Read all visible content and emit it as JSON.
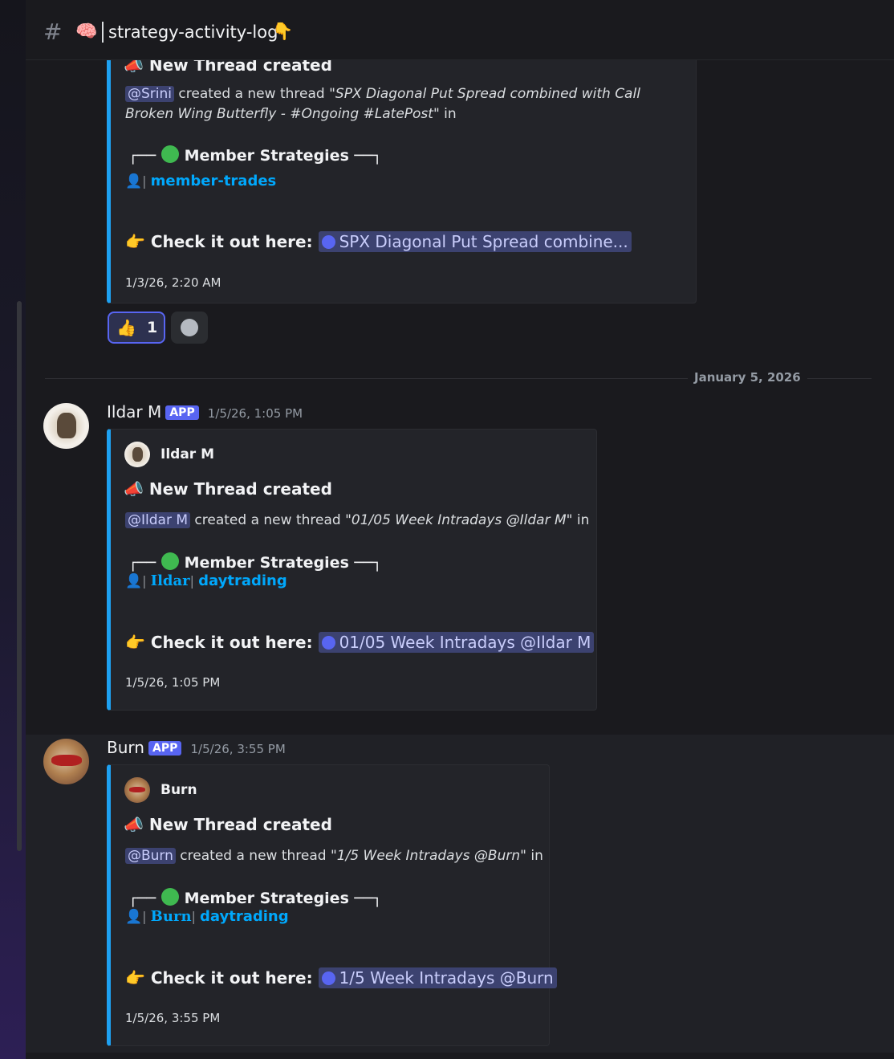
{
  "channel": {
    "emoji_left": "🧠",
    "name": "strategy-activity-log",
    "emoji_right": "👇"
  },
  "messages": [
    {
      "embed": {
        "title": "New Thread created",
        "title_emoji": "📣",
        "mention": "@Srini",
        "desc_text": " created a new thread ",
        "thread_quote": "\"SPX Diagonal Put Spread combined with Call Broken Wing Butterfly - #Ongoing #LatePost\"",
        "desc_suffix": " in",
        "section_left": "┌──",
        "section_title": "Member Strategies",
        "section_right": "──┐",
        "channel_icon": "👤",
        "channel_link": "member-trades",
        "check_label": "Check it out here:",
        "thread_link": "SPX Diagonal Put Spread combine...",
        "footer_time": "1/3/26, 2:20 AM"
      },
      "reaction": {
        "emoji": "👍",
        "count": "1"
      }
    },
    {
      "username": "Ildar M",
      "badge": "APP",
      "timestamp": "1/5/26, 1:05 PM",
      "embed": {
        "author": "Ildar M",
        "title": "New Thread created",
        "title_emoji": "📣",
        "mention": "@Ildar M",
        "desc_text": " created a new thread ",
        "thread_quote": "\"01/05 Week Intradays @Ildar M\"",
        "desc_suffix": " in",
        "section_left": "┌──",
        "section_title": "Member Strategies",
        "section_right": "──┐",
        "channel_icon": "👤",
        "tag_link": "Ildar",
        "channel_link": "daytrading",
        "check_label": "Check it out here:",
        "thread_link": "01/05 Week Intradays @Ildar M",
        "footer_time": "1/5/26, 1:05 PM"
      }
    },
    {
      "username": "Burn",
      "badge": "APP",
      "timestamp": "1/5/26, 3:55 PM",
      "embed": {
        "author": "Burn",
        "title": "New Thread created",
        "title_emoji": "📣",
        "mention": "@Burn",
        "desc_text": " created a new thread ",
        "thread_quote": "\"1/5 Week Intradays @Burn\"",
        "desc_suffix": " in",
        "section_left": "┌──",
        "section_title": "Member Strategies",
        "section_right": "──┐",
        "channel_icon": "👤",
        "tag_link": "Burn",
        "channel_link": "daytrading",
        "check_label": "Check it out here:",
        "thread_link": "1/5 Week Intradays @Burn",
        "footer_time": "1/5/26, 3:55 PM"
      }
    }
  ],
  "date_divider": "January 5, 2026",
  "icons": {
    "pointing": "👉",
    "thread": "speech-bubble-icon",
    "add_reaction": "smiley-icon"
  }
}
